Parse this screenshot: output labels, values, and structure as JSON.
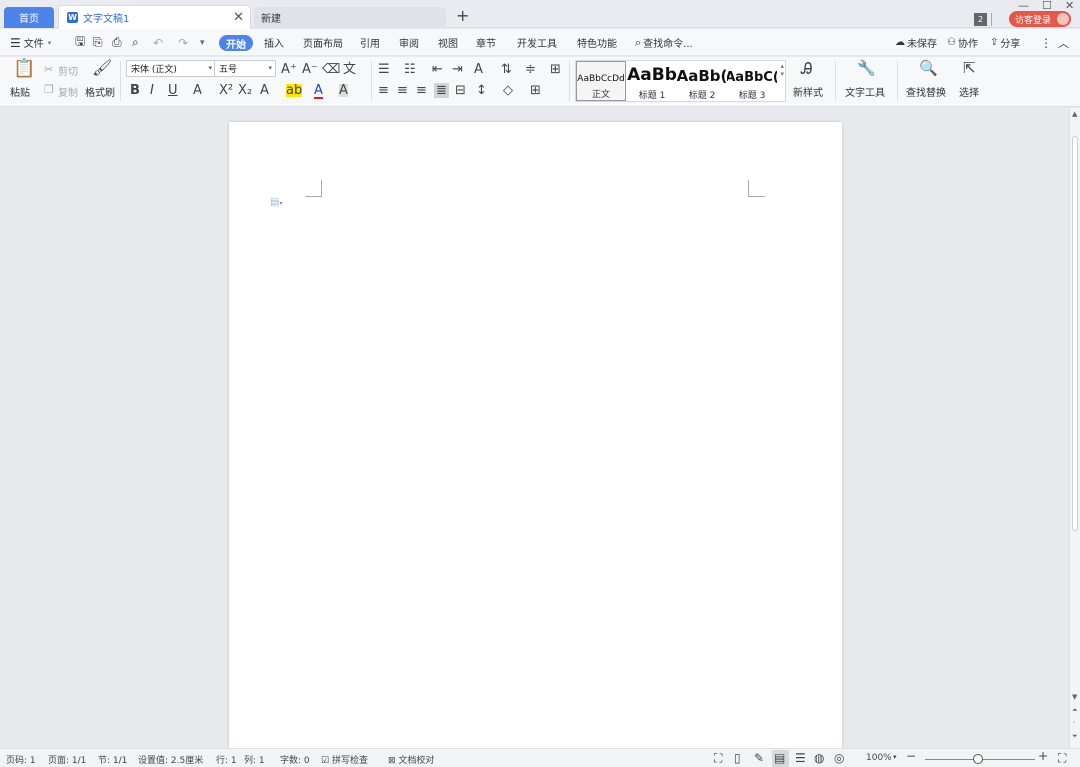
{
  "tabs": {
    "home": "首页",
    "doc": "文字文稿1",
    "new": "新建",
    "badge": "2",
    "login": "访客登录"
  },
  "menu": {
    "file": "文件",
    "items": [
      "开始",
      "插入",
      "页面布局",
      "引用",
      "审阅",
      "视图",
      "章节",
      "开发工具",
      "特色功能"
    ],
    "search": "查找命令...",
    "unsaved": "未保存",
    "collab": "协作",
    "share": "分享"
  },
  "ribbon": {
    "paste": "粘贴",
    "cut": "剪切",
    "copy": "复制",
    "format_painter": "格式刷",
    "font_name": "宋体 (正文)",
    "font_size": "五号",
    "styles": [
      {
        "sample": "AaBbCcDd",
        "label": "正文"
      },
      {
        "sample": "AaBb",
        "label": "标题 1"
      },
      {
        "sample": "AaBb(",
        "label": "标题 2"
      },
      {
        "sample": "AaBbC(",
        "label": "标题 3"
      }
    ],
    "new_style": "新样式",
    "text_tools": "文字工具",
    "find_replace": "查找替换",
    "select": "选择"
  },
  "status": {
    "page": "页码: 1",
    "pages": "页面: 1/1",
    "section": "节: 1/1",
    "setting": "设置值: 2.5厘米",
    "row": "行: 1",
    "col": "列: 1",
    "words": "字数: 0",
    "spell": "拼写检查",
    "proof": "文档校对",
    "zoom": "100%"
  }
}
